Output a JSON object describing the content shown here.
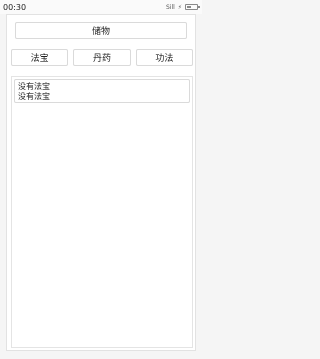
{
  "status_bar": {
    "time": "00:30",
    "signal_text": "Sill",
    "charge_symbol": "⚡"
  },
  "panel": {
    "title": "储物"
  },
  "tabs": [
    {
      "label": "法宝"
    },
    {
      "label": "丹药"
    },
    {
      "label": "功法"
    }
  ],
  "list": {
    "items": [
      {
        "text": "没有法宝"
      },
      {
        "text": "没有法宝"
      }
    ]
  }
}
